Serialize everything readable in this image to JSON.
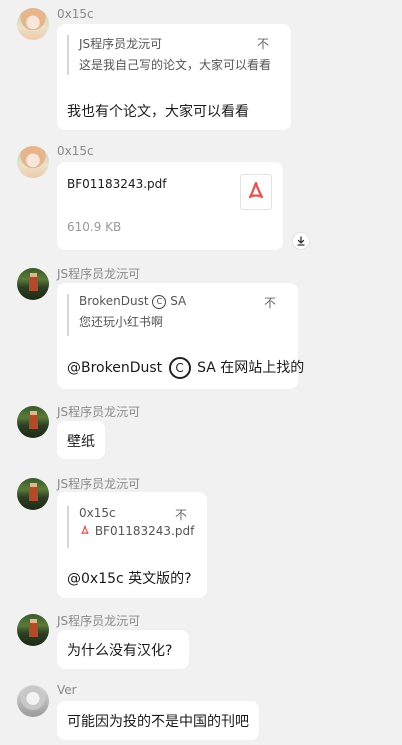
{
  "messages": [
    {
      "sender": "0x15c",
      "quote": {
        "author": "JS程序员龙沅可",
        "text": "这是我自己写的论文，大家可以看看",
        "close": "不"
      },
      "text": "我也有个论文，大家可以看看"
    },
    {
      "sender": "0x15c",
      "file": {
        "name": "BF01183243.pdf",
        "size": "610.9 KB"
      }
    },
    {
      "sender": "JS程序员龙沅可",
      "quote": {
        "author": "BrokenDust",
        "author_suffix": "SA",
        "text": "您还玩小红书啊",
        "close": "不"
      },
      "text_prefix": "@BrokenDust",
      "text_suffix": "SA 在网站上找的"
    },
    {
      "sender": "JS程序员龙沅可",
      "text": "壁纸"
    },
    {
      "sender": "JS程序员龙沅可",
      "quote": {
        "author": "0x15c",
        "file": "BF01183243.pdf",
        "close": "不"
      },
      "text": "@0x15c 英文版的?"
    },
    {
      "sender": "JS程序员龙沅可",
      "text": "为什么没有汉化?"
    },
    {
      "sender": "Ver",
      "text": "可能因为投的不是中国的刊吧"
    }
  ],
  "symbols": {
    "copyright": "C"
  },
  "colors": {
    "pdf_red": "#e5534b",
    "background": "#f1f1f1",
    "bubble": "#ffffff"
  }
}
